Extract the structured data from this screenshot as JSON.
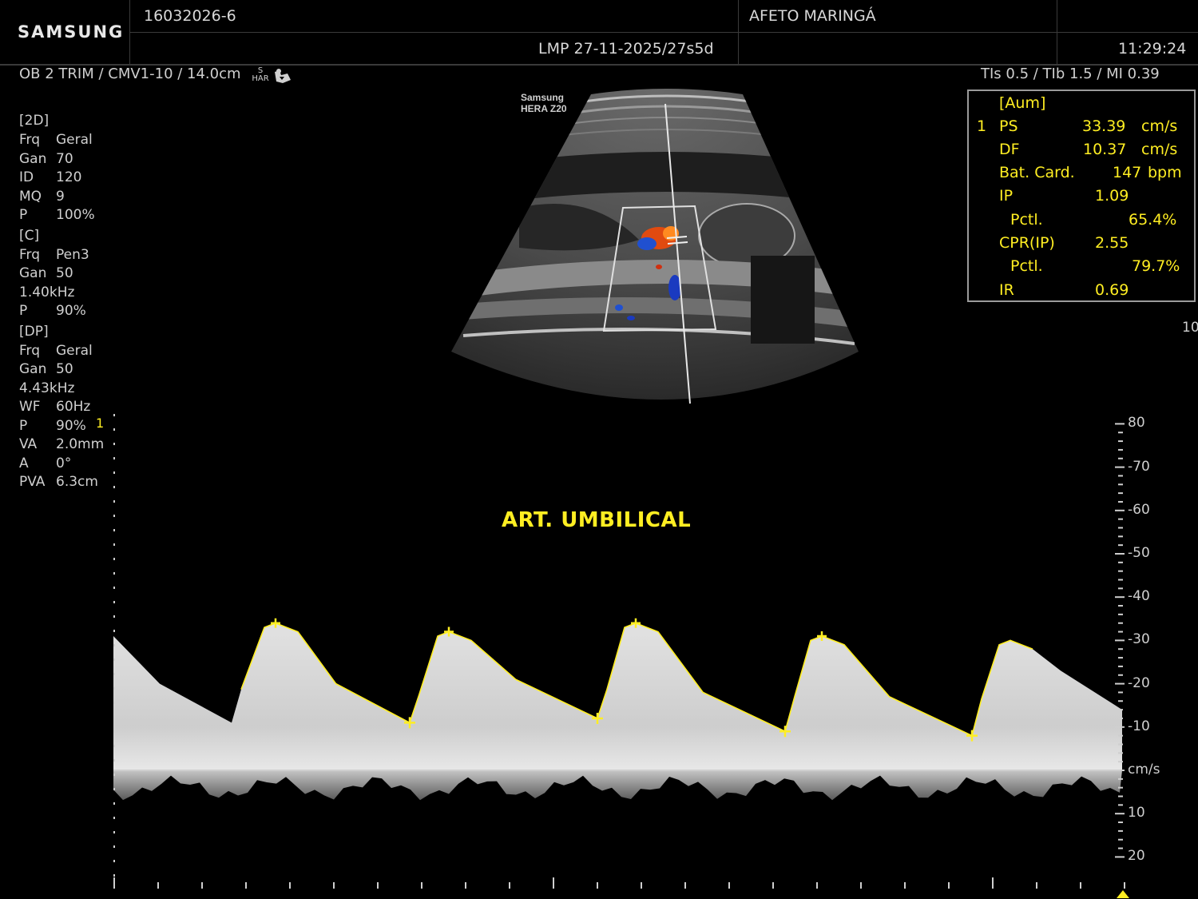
{
  "header": {
    "brand": "SAMSUNG",
    "patient_id": "16032026-6",
    "institution": "AFETO MARINGÁ",
    "lmp": "LMP 27-11-2025/27s5d",
    "time": "11:29:24"
  },
  "subheader": {
    "preset": "OB 2 TRIM / CMV1-10 / 14.0cm",
    "har_top": "S",
    "har_bottom": "HAR",
    "indices": "TIs   0.5 / TIb   1.5 / MI   0.39"
  },
  "probe_watermark": {
    "line1": "Samsung",
    "line2": "HERA Z20"
  },
  "params": {
    "mode_2d": "[2D]",
    "frq_2d_k": "Frq",
    "frq_2d_v": "Geral",
    "gan_2d_k": "Gan",
    "gan_2d_v": "70",
    "id_k": "ID",
    "id_v": "120",
    "mq_k": "MQ",
    "mq_v": "9",
    "p_2d_k": "P",
    "p_2d_v": "100%",
    "mode_c": "[C]",
    "frq_c_k": "Frq",
    "frq_c_v": "Pen3",
    "gan_c_k": "Gan",
    "gan_c_v": "50",
    "prf_c": "1.40kHz",
    "p_c_k": "P",
    "p_c_v": "90%",
    "mode_dp": "[DP]",
    "frq_dp_k": "Frq",
    "frq_dp_v": "Geral",
    "gan_dp_k": "Gan",
    "gan_dp_v": "50",
    "prf_dp": "4.43kHz",
    "wf_k": "WF",
    "wf_v": "60Hz",
    "p_dp_k": "P",
    "p_dp_v": "90%",
    "va_k": "VA",
    "va_v": "2.0mm",
    "a_k": "A",
    "a_v": "0°",
    "pva_k": "PVA",
    "pva_v": "6.3cm"
  },
  "measurements": {
    "header": "[Aum]",
    "index": "1",
    "rows": [
      {
        "label": "PS",
        "value": "33.39",
        "unit": "cm/s"
      },
      {
        "label": "DF",
        "value": "10.37",
        "unit": "cm/s"
      },
      {
        "label": "Bat. Card.",
        "value": "147",
        "unit": "bpm"
      },
      {
        "label": "IP",
        "value": "1.09",
        "unit": ""
      },
      {
        "label": "Pctl.",
        "value": "65.4%",
        "unit": ""
      },
      {
        "label": "CPR(IP)",
        "value": "2.55",
        "unit": ""
      },
      {
        "label": "Pctl.",
        "value": "79.7%",
        "unit": ""
      },
      {
        "label": "IR",
        "value": "0.69",
        "unit": ""
      }
    ]
  },
  "doppler": {
    "label": "ART. UMBILICAL",
    "gate_marker": "1",
    "unit": "cm/s",
    "scale_top": "80",
    "scale_labels": [
      "-70",
      "-60",
      "-50",
      "-40",
      "-30",
      "-20",
      "-10",
      "cm/s",
      "10",
      "20"
    ],
    "side_cut_label": "10",
    "peaks_cm_s": [
      34,
      32,
      34,
      31
    ],
    "troughs_cm_s": [
      11,
      12,
      9,
      8
    ],
    "color_yellow": "#ffee22"
  }
}
